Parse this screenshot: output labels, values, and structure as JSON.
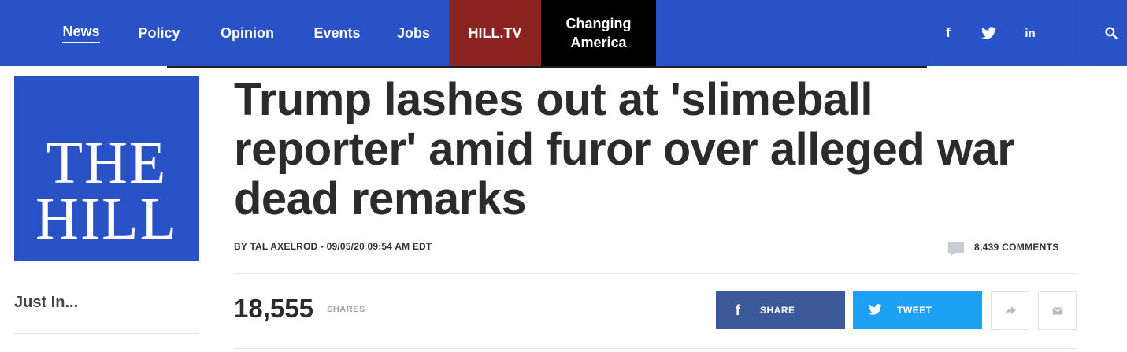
{
  "nav": {
    "items": [
      {
        "label": "News",
        "active": true
      },
      {
        "label": "Policy"
      },
      {
        "label": "Opinion"
      },
      {
        "label": "Events"
      },
      {
        "label": "Jobs"
      },
      {
        "label": "HILL.TV"
      },
      {
        "label_line1": "Changing",
        "label_line2": "America"
      }
    ],
    "social": [
      "facebook-icon",
      "twitter-icon",
      "linkedin-icon"
    ],
    "search_icon": "search-icon",
    "colors": {
      "bar": "#2952c7",
      "hilltv": "#8b2320",
      "changing": "#000000"
    }
  },
  "logo": {
    "line1": "THE",
    "line2": "HILL",
    "color": "#2952c7"
  },
  "article": {
    "headline": "Trump lashes out at 'slimeball reporter' amid furor over alleged war dead remarks",
    "byline": "BY TAL AXELROD - 09/05/20 09:54 AM EDT",
    "comments": "8,439 COMMENTS",
    "shares_count": "18,555",
    "shares_label": "SHARES"
  },
  "sidebar": {
    "just_in": "Just In..."
  },
  "share": {
    "facebook_label": "SHARE",
    "twitter_label": "TWEET",
    "facebook_color": "#3b5898",
    "twitter_color": "#1da1f2"
  }
}
